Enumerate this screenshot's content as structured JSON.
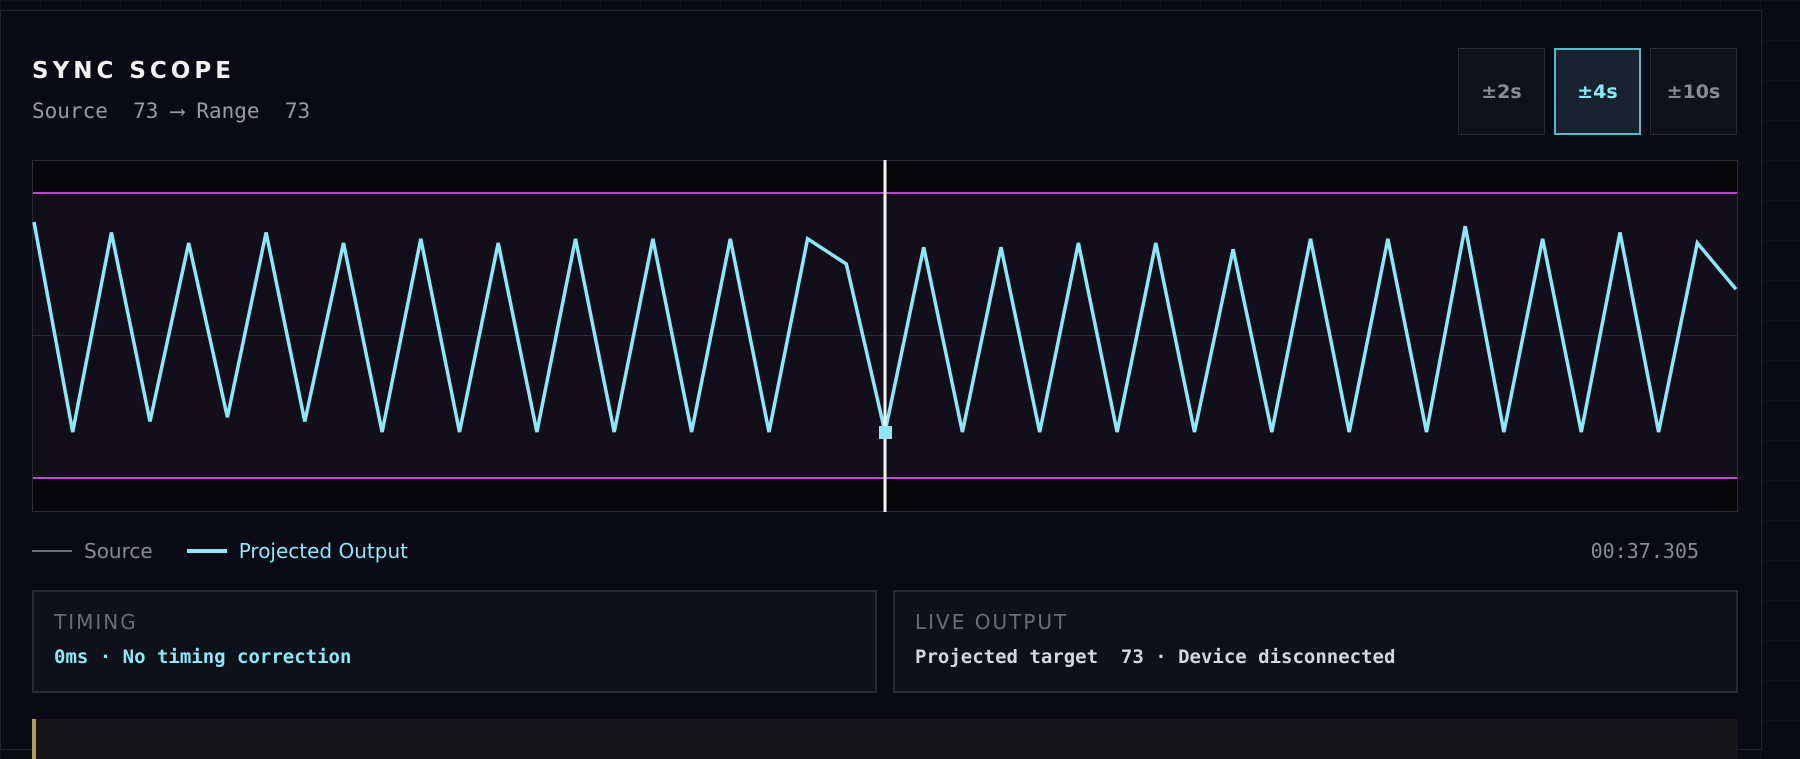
{
  "header": {
    "title": "SYNC SCOPE",
    "subtitle": "Source  73 ⟶ Range  73"
  },
  "range_buttons": [
    {
      "label": "±2s",
      "active": false
    },
    {
      "label": "±4s",
      "active": true
    },
    {
      "label": "±10s",
      "active": false
    }
  ],
  "scope": {
    "series": [
      {
        "name": "Projected Output",
        "values": [
          1.0,
          0.0,
          0.95,
          0.05,
          0.9,
          0.07,
          0.95,
          0.05,
          0.9,
          0.0,
          0.92,
          0.0,
          0.9,
          0.0,
          0.92,
          0.0,
          0.92,
          0.0,
          0.92,
          0.0,
          0.92,
          0.8,
          0.0,
          0.88,
          0.0,
          0.88,
          0.0,
          0.9,
          0.0,
          0.9,
          0.0,
          0.87,
          0.0,
          0.92,
          0.0,
          0.92,
          0.0,
          0.98,
          0.0,
          0.92,
          0.0,
          0.95,
          0.0,
          0.9,
          0.68
        ]
      }
    ],
    "playhead": 0.5,
    "colors": {
      "output": "#8ee6f8",
      "limits": "#b44cc8",
      "playhead": "#f4f4f4",
      "grid": "#2a2a34"
    }
  },
  "legend": {
    "source_label": "Source",
    "output_label": "Projected Output"
  },
  "clock": "00:37.305",
  "cards": {
    "timing": {
      "caption": "TIMING",
      "value": "0ms · No timing correction"
    },
    "live": {
      "caption": "LIVE OUTPUT",
      "value": "Projected target  73 · Device disconnected"
    }
  },
  "theme": {
    "accent": "#8ee6f8",
    "bg": "#0a0a16"
  }
}
